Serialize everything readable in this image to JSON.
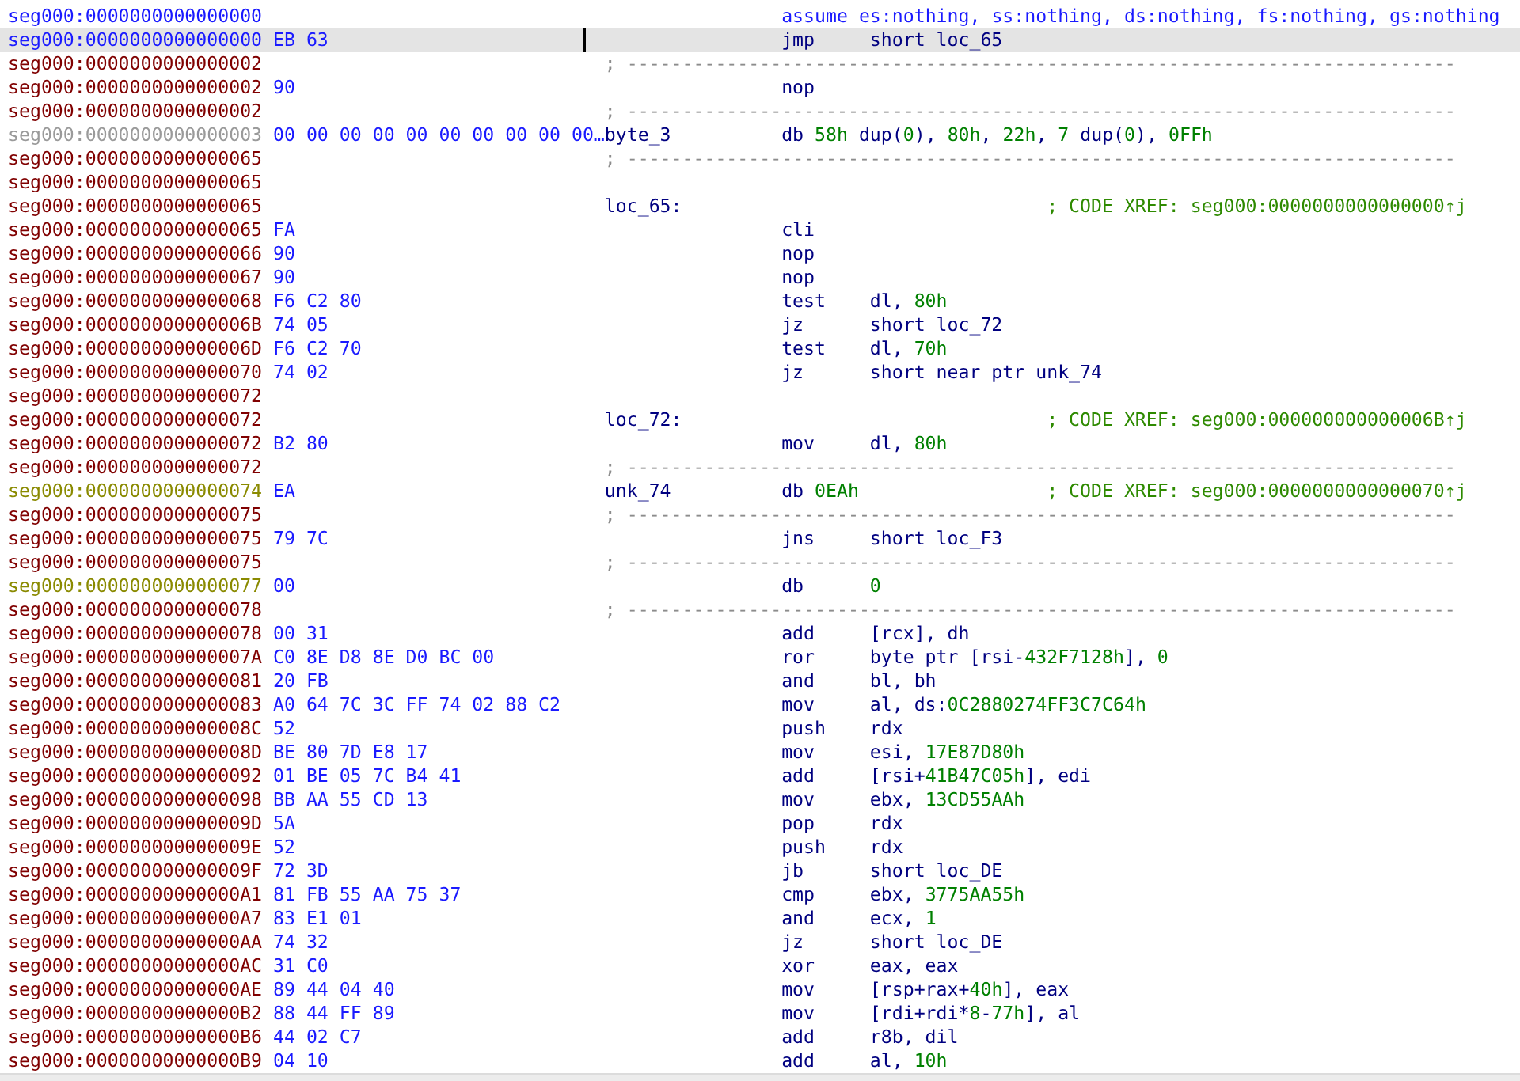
{
  "listing": {
    "rows": [
      {
        "address": "seg000:0000000000000000",
        "color": "#1a1aff",
        "kind": "directive",
        "text": "assume es:nothing, ss:nothing, ds:nothing, fs:nothing, gs:nothing",
        "selected": false
      },
      {
        "address": "seg000:0000000000000000",
        "color": "#1a1aff",
        "bytes": "EB 63",
        "kind": "instr",
        "mnemonic": "jmp",
        "operands": [
          {
            "text": "short loc_65",
            "kind": "reg"
          }
        ],
        "selected": true
      },
      {
        "address": "seg000:0000000000000002",
        "color": "#800000",
        "kind": "separator",
        "text": "; ---------------------------------------------------------------------------",
        "selected": false
      },
      {
        "address": "seg000:0000000000000002",
        "color": "#800000",
        "bytes": "90",
        "kind": "instr",
        "mnemonic": "nop",
        "selected": false
      },
      {
        "address": "seg000:0000000000000002",
        "color": "#800000",
        "kind": "separator",
        "text": "; ---------------------------------------------------------------------------",
        "selected": false
      },
      {
        "address": "seg000:0000000000000003",
        "color": "#9a9a9a",
        "bytes": "00 00 00 00 00 00 00 00 00 00…",
        "label": "byte_3",
        "kind": "data",
        "mnemonic": "db",
        "operands": [
          {
            "text": "58h",
            "kind": "num"
          },
          {
            "text": " dup(",
            "kind": "reg"
          },
          {
            "text": "0",
            "kind": "num"
          },
          {
            "text": "), ",
            "kind": "reg"
          },
          {
            "text": "80h",
            "kind": "num"
          },
          {
            "text": ", ",
            "kind": "reg"
          },
          {
            "text": "22h",
            "kind": "num"
          },
          {
            "text": ", ",
            "kind": "reg"
          },
          {
            "text": "7",
            "kind": "num"
          },
          {
            "text": " dup(",
            "kind": "reg"
          },
          {
            "text": "0",
            "kind": "num"
          },
          {
            "text": "), ",
            "kind": "reg"
          },
          {
            "text": "0FFh",
            "kind": "num"
          }
        ],
        "selected": false
      },
      {
        "address": "seg000:0000000000000065",
        "color": "#800000",
        "kind": "separator",
        "text": "; ---------------------------------------------------------------------------",
        "selected": false
      },
      {
        "address": "seg000:0000000000000065",
        "color": "#800000",
        "kind": "blank",
        "selected": false
      },
      {
        "address": "seg000:0000000000000065",
        "color": "#800000",
        "kind": "label",
        "label": "loc_65:",
        "comment": "; CODE XREF: seg000:0000000000000000↑j",
        "selected": false
      },
      {
        "address": "seg000:0000000000000065",
        "color": "#800000",
        "bytes": "FA",
        "kind": "instr",
        "mnemonic": "cli",
        "selected": false
      },
      {
        "address": "seg000:0000000000000066",
        "color": "#800000",
        "bytes": "90",
        "kind": "instr",
        "mnemonic": "nop",
        "selected": false
      },
      {
        "address": "seg000:0000000000000067",
        "color": "#800000",
        "bytes": "90",
        "kind": "instr",
        "mnemonic": "nop",
        "selected": false
      },
      {
        "address": "seg000:0000000000000068",
        "color": "#800000",
        "bytes": "F6 C2 80",
        "kind": "instr",
        "mnemonic": "test",
        "operands": [
          {
            "text": "dl, ",
            "kind": "reg"
          },
          {
            "text": "80h",
            "kind": "num"
          }
        ],
        "selected": false
      },
      {
        "address": "seg000:000000000000006B",
        "color": "#800000",
        "bytes": "74 05",
        "kind": "instr",
        "mnemonic": "jz",
        "operands": [
          {
            "text": "short loc_72",
            "kind": "reg"
          }
        ],
        "selected": false
      },
      {
        "address": "seg000:000000000000006D",
        "color": "#800000",
        "bytes": "F6 C2 70",
        "kind": "instr",
        "mnemonic": "test",
        "operands": [
          {
            "text": "dl, ",
            "kind": "reg"
          },
          {
            "text": "70h",
            "kind": "num"
          }
        ],
        "selected": false
      },
      {
        "address": "seg000:0000000000000070",
        "color": "#800000",
        "bytes": "74 02",
        "kind": "instr",
        "mnemonic": "jz",
        "operands": [
          {
            "text": "short near ptr unk_74",
            "kind": "reg"
          }
        ],
        "selected": false
      },
      {
        "address": "seg000:0000000000000072",
        "color": "#800000",
        "kind": "blank",
        "selected": false
      },
      {
        "address": "seg000:0000000000000072",
        "color": "#800000",
        "kind": "label",
        "label": "loc_72:",
        "comment": "; CODE XREF: seg000:000000000000006B↑j",
        "selected": false
      },
      {
        "address": "seg000:0000000000000072",
        "color": "#800000",
        "bytes": "B2 80",
        "kind": "instr",
        "mnemonic": "mov",
        "operands": [
          {
            "text": "dl, ",
            "kind": "reg"
          },
          {
            "text": "80h",
            "kind": "num"
          }
        ],
        "selected": false
      },
      {
        "address": "seg000:0000000000000072",
        "color": "#800000",
        "kind": "separator",
        "text": "; ---------------------------------------------------------------------------",
        "selected": false
      },
      {
        "address": "seg000:0000000000000074",
        "color": "#8a8a00",
        "bytes": "EA",
        "label": "unk_74",
        "kind": "data",
        "mnemonic": "db",
        "operands": [
          {
            "text": "0EAh",
            "kind": "num"
          }
        ],
        "comment": "; CODE XREF: seg000:0000000000000070↑j",
        "selected": false
      },
      {
        "address": "seg000:0000000000000075",
        "color": "#800000",
        "kind": "separator",
        "text": "; ---------------------------------------------------------------------------",
        "selected": false
      },
      {
        "address": "seg000:0000000000000075",
        "color": "#800000",
        "bytes": "79 7C",
        "kind": "instr",
        "mnemonic": "jns",
        "operands": [
          {
            "text": "short loc_F3",
            "kind": "reg"
          }
        ],
        "selected": false
      },
      {
        "address": "seg000:0000000000000075",
        "color": "#800000",
        "kind": "separator",
        "text": "; ---------------------------------------------------------------------------",
        "selected": false
      },
      {
        "address": "seg000:0000000000000077",
        "color": "#8a8a00",
        "bytes": "00",
        "kind": "instr",
        "mnemonic": "db",
        "operands": [
          {
            "text": "0",
            "kind": "num"
          }
        ],
        "selected": false
      },
      {
        "address": "seg000:0000000000000078",
        "color": "#800000",
        "kind": "separator",
        "text": "; ---------------------------------------------------------------------------",
        "selected": false
      },
      {
        "address": "seg000:0000000000000078",
        "color": "#800000",
        "bytes": "00 31",
        "kind": "instr",
        "mnemonic": "add",
        "operands": [
          {
            "text": "[rcx], dh",
            "kind": "reg"
          }
        ],
        "selected": false
      },
      {
        "address": "seg000:000000000000007A",
        "color": "#800000",
        "bytes": "C0 8E D8 8E D0 BC 00",
        "kind": "instr",
        "mnemonic": "ror",
        "operands": [
          {
            "text": "byte ptr [rsi-",
            "kind": "reg"
          },
          {
            "text": "432F7128h",
            "kind": "num"
          },
          {
            "text": "], ",
            "kind": "reg"
          },
          {
            "text": "0",
            "kind": "num"
          }
        ],
        "selected": false
      },
      {
        "address": "seg000:0000000000000081",
        "color": "#800000",
        "bytes": "20 FB",
        "kind": "instr",
        "mnemonic": "and",
        "operands": [
          {
            "text": "bl, bh",
            "kind": "reg"
          }
        ],
        "selected": false
      },
      {
        "address": "seg000:0000000000000083",
        "color": "#800000",
        "bytes": "A0 64 7C 3C FF 74 02 88 C2",
        "kind": "instr",
        "mnemonic": "mov",
        "operands": [
          {
            "text": "al, ds:",
            "kind": "reg"
          },
          {
            "text": "0C2880274FF3C7C64h",
            "kind": "num"
          }
        ],
        "selected": false
      },
      {
        "address": "seg000:000000000000008C",
        "color": "#800000",
        "bytes": "52",
        "kind": "instr",
        "mnemonic": "push",
        "operands": [
          {
            "text": "rdx",
            "kind": "reg"
          }
        ],
        "selected": false
      },
      {
        "address": "seg000:000000000000008D",
        "color": "#800000",
        "bytes": "BE 80 7D E8 17",
        "kind": "instr",
        "mnemonic": "mov",
        "operands": [
          {
            "text": "esi, ",
            "kind": "reg"
          },
          {
            "text": "17E87D80h",
            "kind": "num"
          }
        ],
        "selected": false
      },
      {
        "address": "seg000:0000000000000092",
        "color": "#800000",
        "bytes": "01 BE 05 7C B4 41",
        "kind": "instr",
        "mnemonic": "add",
        "operands": [
          {
            "text": "[rsi+",
            "kind": "reg"
          },
          {
            "text": "41B47C05h",
            "kind": "num"
          },
          {
            "text": "], edi",
            "kind": "reg"
          }
        ],
        "selected": false
      },
      {
        "address": "seg000:0000000000000098",
        "color": "#800000",
        "bytes": "BB AA 55 CD 13",
        "kind": "instr",
        "mnemonic": "mov",
        "operands": [
          {
            "text": "ebx, ",
            "kind": "reg"
          },
          {
            "text": "13CD55AAh",
            "kind": "num"
          }
        ],
        "selected": false
      },
      {
        "address": "seg000:000000000000009D",
        "color": "#800000",
        "bytes": "5A",
        "kind": "instr",
        "mnemonic": "pop",
        "operands": [
          {
            "text": "rdx",
            "kind": "reg"
          }
        ],
        "selected": false
      },
      {
        "address": "seg000:000000000000009E",
        "color": "#800000",
        "bytes": "52",
        "kind": "instr",
        "mnemonic": "push",
        "operands": [
          {
            "text": "rdx",
            "kind": "reg"
          }
        ],
        "selected": false
      },
      {
        "address": "seg000:000000000000009F",
        "color": "#800000",
        "bytes": "72 3D",
        "kind": "instr",
        "mnemonic": "jb",
        "operands": [
          {
            "text": "short loc_DE",
            "kind": "reg"
          }
        ],
        "selected": false
      },
      {
        "address": "seg000:00000000000000A1",
        "color": "#800000",
        "bytes": "81 FB 55 AA 75 37",
        "kind": "instr",
        "mnemonic": "cmp",
        "operands": [
          {
            "text": "ebx, ",
            "kind": "reg"
          },
          {
            "text": "3775AA55h",
            "kind": "num"
          }
        ],
        "selected": false
      },
      {
        "address": "seg000:00000000000000A7",
        "color": "#800000",
        "bytes": "83 E1 01",
        "kind": "instr",
        "mnemonic": "and",
        "operands": [
          {
            "text": "ecx, ",
            "kind": "reg"
          },
          {
            "text": "1",
            "kind": "num"
          }
        ],
        "selected": false
      },
      {
        "address": "seg000:00000000000000AA",
        "color": "#800000",
        "bytes": "74 32",
        "kind": "instr",
        "mnemonic": "jz",
        "operands": [
          {
            "text": "short loc_DE",
            "kind": "reg"
          }
        ],
        "selected": false
      },
      {
        "address": "seg000:00000000000000AC",
        "color": "#800000",
        "bytes": "31 C0",
        "kind": "instr",
        "mnemonic": "xor",
        "operands": [
          {
            "text": "eax, eax",
            "kind": "reg"
          }
        ],
        "selected": false
      },
      {
        "address": "seg000:00000000000000AE",
        "color": "#800000",
        "bytes": "89 44 04 40",
        "kind": "instr",
        "mnemonic": "mov",
        "operands": [
          {
            "text": "[rsp+rax+",
            "kind": "reg"
          },
          {
            "text": "40h",
            "kind": "num"
          },
          {
            "text": "], eax",
            "kind": "reg"
          }
        ],
        "selected": false
      },
      {
        "address": "seg000:00000000000000B2",
        "color": "#800000",
        "bytes": "88 44 FF 89",
        "kind": "instr",
        "mnemonic": "mov",
        "operands": [
          {
            "text": "[rdi+rdi*",
            "kind": "reg"
          },
          {
            "text": "8",
            "kind": "num"
          },
          {
            "text": "-",
            "kind": "reg"
          },
          {
            "text": "77h",
            "kind": "num"
          },
          {
            "text": "], al",
            "kind": "reg"
          }
        ],
        "selected": false
      },
      {
        "address": "seg000:00000000000000B6",
        "color": "#800000",
        "bytes": "44 02 C7",
        "kind": "instr",
        "mnemonic": "add",
        "operands": [
          {
            "text": "r8b, dil",
            "kind": "reg"
          }
        ],
        "selected": false
      },
      {
        "address": "seg000:00000000000000B9",
        "color": "#800000",
        "bytes": "04 10",
        "kind": "instr",
        "mnemonic": "add",
        "operands": [
          {
            "text": "al, ",
            "kind": "reg"
          },
          {
            "text": "10h",
            "kind": "num"
          }
        ],
        "selected": false
      }
    ]
  }
}
